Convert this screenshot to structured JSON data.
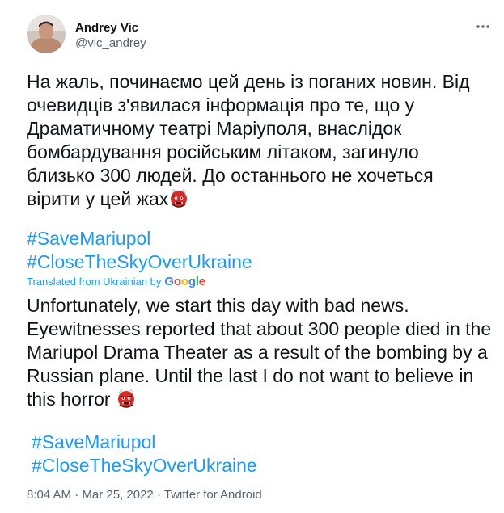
{
  "tweet": {
    "author_name": "Andrey Vic",
    "author_handle": "@vic_andrey",
    "original_text": "На жаль, починаємо цей день із поганих новин. Від очевидців з'явилася інформація про те, що у Драматичному театрі Маріуполя, внаслідок бомбардування російським літаком, загинуло близько 300 людей. До останнього не хочеться вірити у цей жах",
    "original_hashtags": [
      "#SaveMariupol",
      "#CloseTheSkyOverUkraine"
    ],
    "translated_label": "Translated from Ukrainian by",
    "google_letters": [
      "G",
      "o",
      "o",
      "g",
      "l",
      "e"
    ],
    "translated_text": "Unfortunately, we start this day with bad news. Eyewitnesses reported that about 300 people died in the Mariupol Drama Theater as a result of the bombing by a Russian plane. Until the last I do not want to believe in this horror",
    "translated_hashtags": [
      "#SaveMariupol",
      "#CloseTheSkyOverUkraine"
    ],
    "time": "8:04 AM",
    "separator": "·",
    "date": "Mar 25, 2022",
    "source": "Twitter for Android",
    "emoji": "ogre-emoji",
    "avatar": "avatar-photo",
    "more_icon": "more-options-icon"
  },
  "colors": {
    "link": "#1d9bf0",
    "text": "#0f1419",
    "secondary": "#536471",
    "emoji_red": "#d62b2b"
  }
}
